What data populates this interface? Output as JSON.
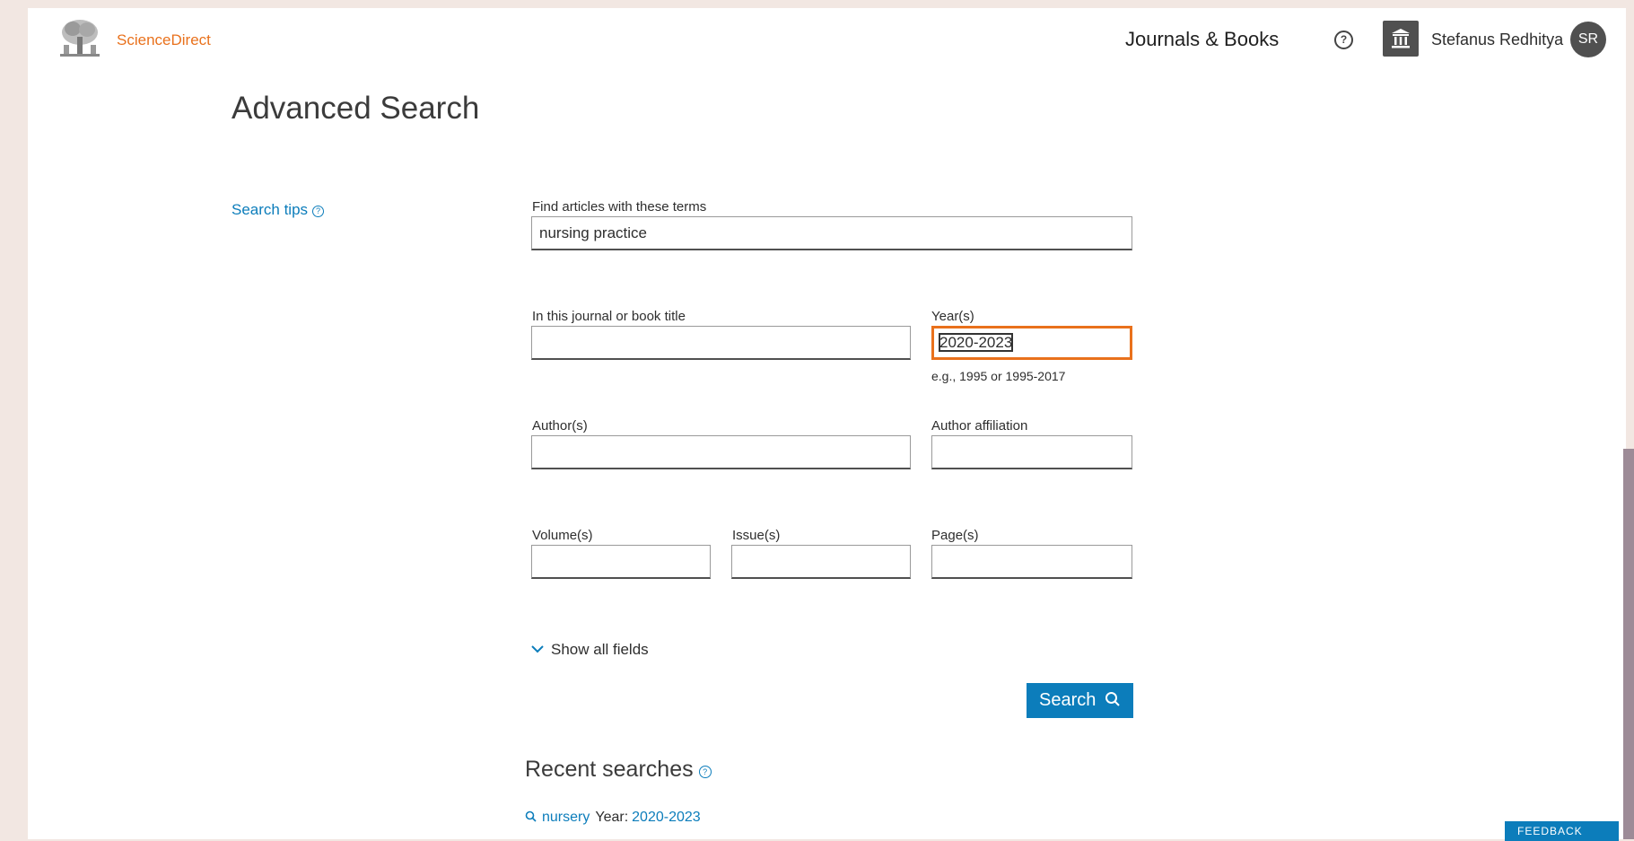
{
  "header": {
    "brand": "ScienceDirect",
    "nav_journals": "Journals & Books",
    "help_symbol": "?",
    "institution_icon": "institution-icon",
    "username": "Stefanus Redhitya",
    "avatar_initials": "SR"
  },
  "page": {
    "title": "Advanced Search",
    "search_tips": "Search tips",
    "help_symbol": "?"
  },
  "form": {
    "terms_label": "Find articles with these terms",
    "terms_value": "nursing practice",
    "journal_label": "In this journal or book title",
    "journal_value": "",
    "years_label": "Year(s)",
    "years_value": "2020-2023",
    "years_hint": "e.g., 1995 or 1995-2017",
    "authors_label": "Author(s)",
    "authors_value": "",
    "affiliation_label": "Author affiliation",
    "affiliation_value": "",
    "volume_label": "Volume(s)",
    "volume_value": "",
    "issue_label": "Issue(s)",
    "issue_value": "",
    "pages_label": "Page(s)",
    "pages_value": "",
    "show_all_fields": "Show all fields",
    "search_button": "Search"
  },
  "recent": {
    "title": "Recent searches",
    "items": [
      {
        "term": "nursery",
        "year_label": "Year:",
        "year_value": "2020-2023"
      }
    ]
  },
  "feedback_label": "FEEDBACK"
}
